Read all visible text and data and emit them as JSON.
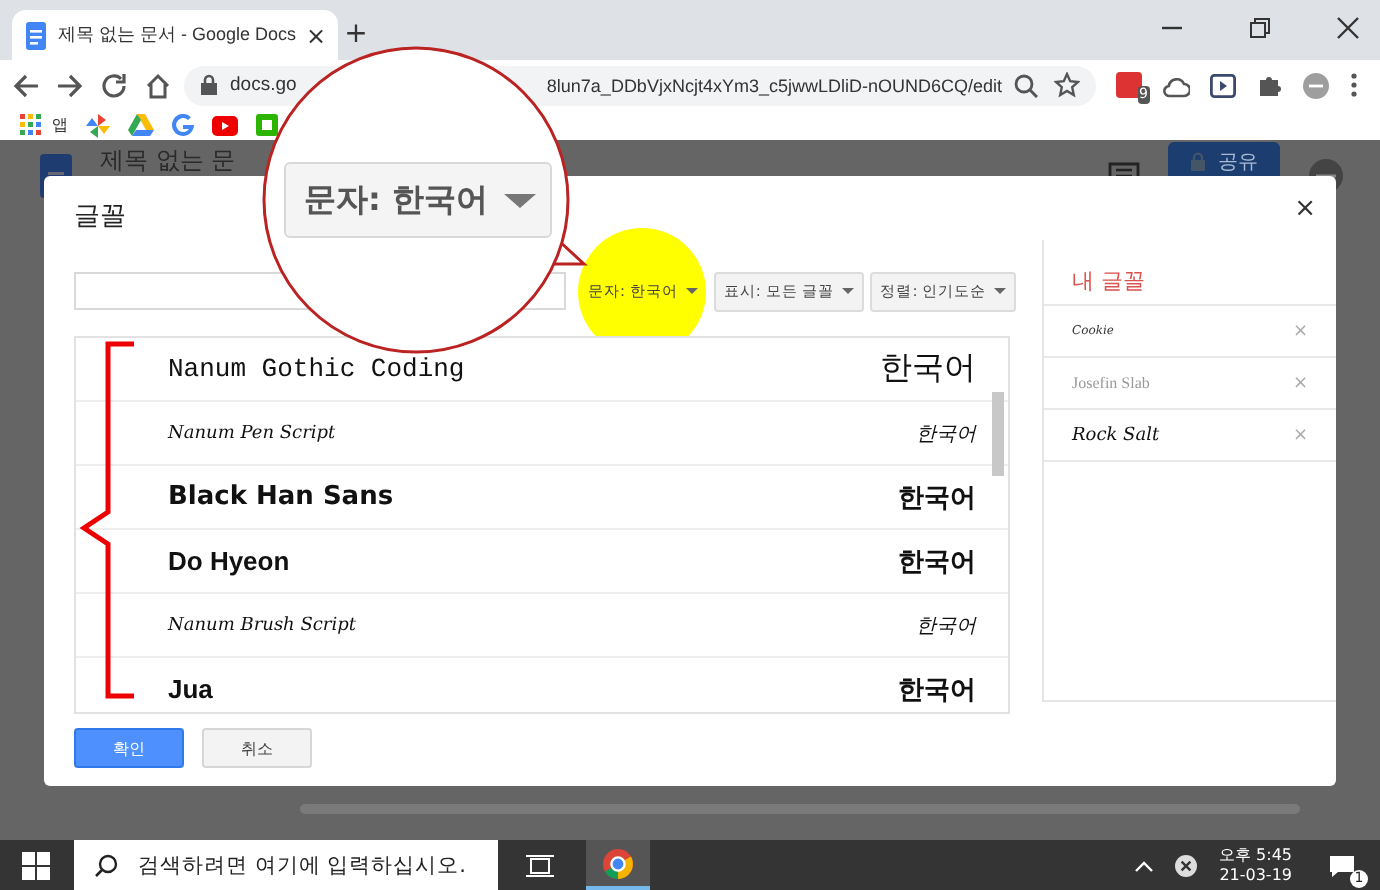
{
  "browser": {
    "tab": {
      "title": "제목 없는 문서 - Google Docs",
      "close": "×"
    },
    "new_tab": "+",
    "url_start": "docs.go",
    "url_end": "8lun7a_DDbVjxNcjt4xYm3_c5jwwLDliD-nOUND6CQ/edit",
    "extension_badge": "9",
    "bookmarks": [
      {
        "label": "앱"
      }
    ]
  },
  "docs": {
    "title": "제목 없는 문",
    "share": "공유"
  },
  "dialog": {
    "title": "글꼴",
    "close": "×",
    "filters": [
      {
        "label": "문자: 한국어",
        "highlighted": true
      },
      {
        "label": "표시: 모든 글꼴",
        "highlighted": false
      },
      {
        "label": "정렬: 인기도순",
        "highlighted": false
      }
    ],
    "fonts": [
      {
        "name": "Nanum Gothic Coding",
        "sample": "한국어",
        "kind": "mono"
      },
      {
        "name": "Nanum Pen Script",
        "sample": "한국어",
        "kind": "script"
      },
      {
        "name": "Black Han Sans",
        "sample": "한국어",
        "kind": "heavy"
      },
      {
        "name": "Do Hyeon",
        "sample": "한국어",
        "kind": "bold"
      },
      {
        "name": "Nanum Brush Script",
        "sample": "한국어",
        "kind": "script"
      },
      {
        "name": "Jua",
        "sample": "한국어",
        "kind": "bold"
      }
    ],
    "my_fonts": {
      "title": "내 글꼴",
      "items": [
        {
          "name": "Cookie",
          "remove": "×",
          "kind": "tiny"
        },
        {
          "name": "Josefin Slab",
          "remove": "×",
          "kind": "light"
        },
        {
          "name": "Rock Salt",
          "remove": "×",
          "kind": "hand"
        }
      ]
    },
    "buttons": [
      {
        "label": "확인",
        "kind": "primary"
      },
      {
        "label": "취소",
        "kind": "secondary"
      }
    ]
  },
  "callout": {
    "label": "문자: 한국어"
  },
  "taskbar": {
    "search_placeholder": "검색하려면 여기에 입력하십시오.",
    "time": "오후 5:45",
    "date": "21-03-19",
    "notification_count": "1"
  }
}
